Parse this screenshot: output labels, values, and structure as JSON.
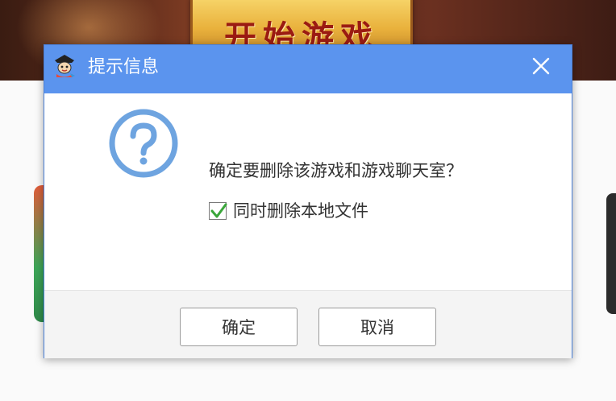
{
  "background": {
    "banner_button_label": "开始游戏"
  },
  "dialog": {
    "title": "提示信息",
    "message": "确定要删除该游戏和游戏聊天室？",
    "checkbox": {
      "label": "同时删除本地文件",
      "checked": true
    },
    "buttons": {
      "ok_label": "确定",
      "cancel_label": "取消"
    },
    "icons": {
      "app": "qq-game-penguin-icon",
      "close": "close-icon",
      "question": "question-icon",
      "check": "check-icon"
    },
    "colors": {
      "titlebar": "#5b94ee",
      "question_icon": "#6ea4e0",
      "check": "#3aa63a"
    }
  }
}
